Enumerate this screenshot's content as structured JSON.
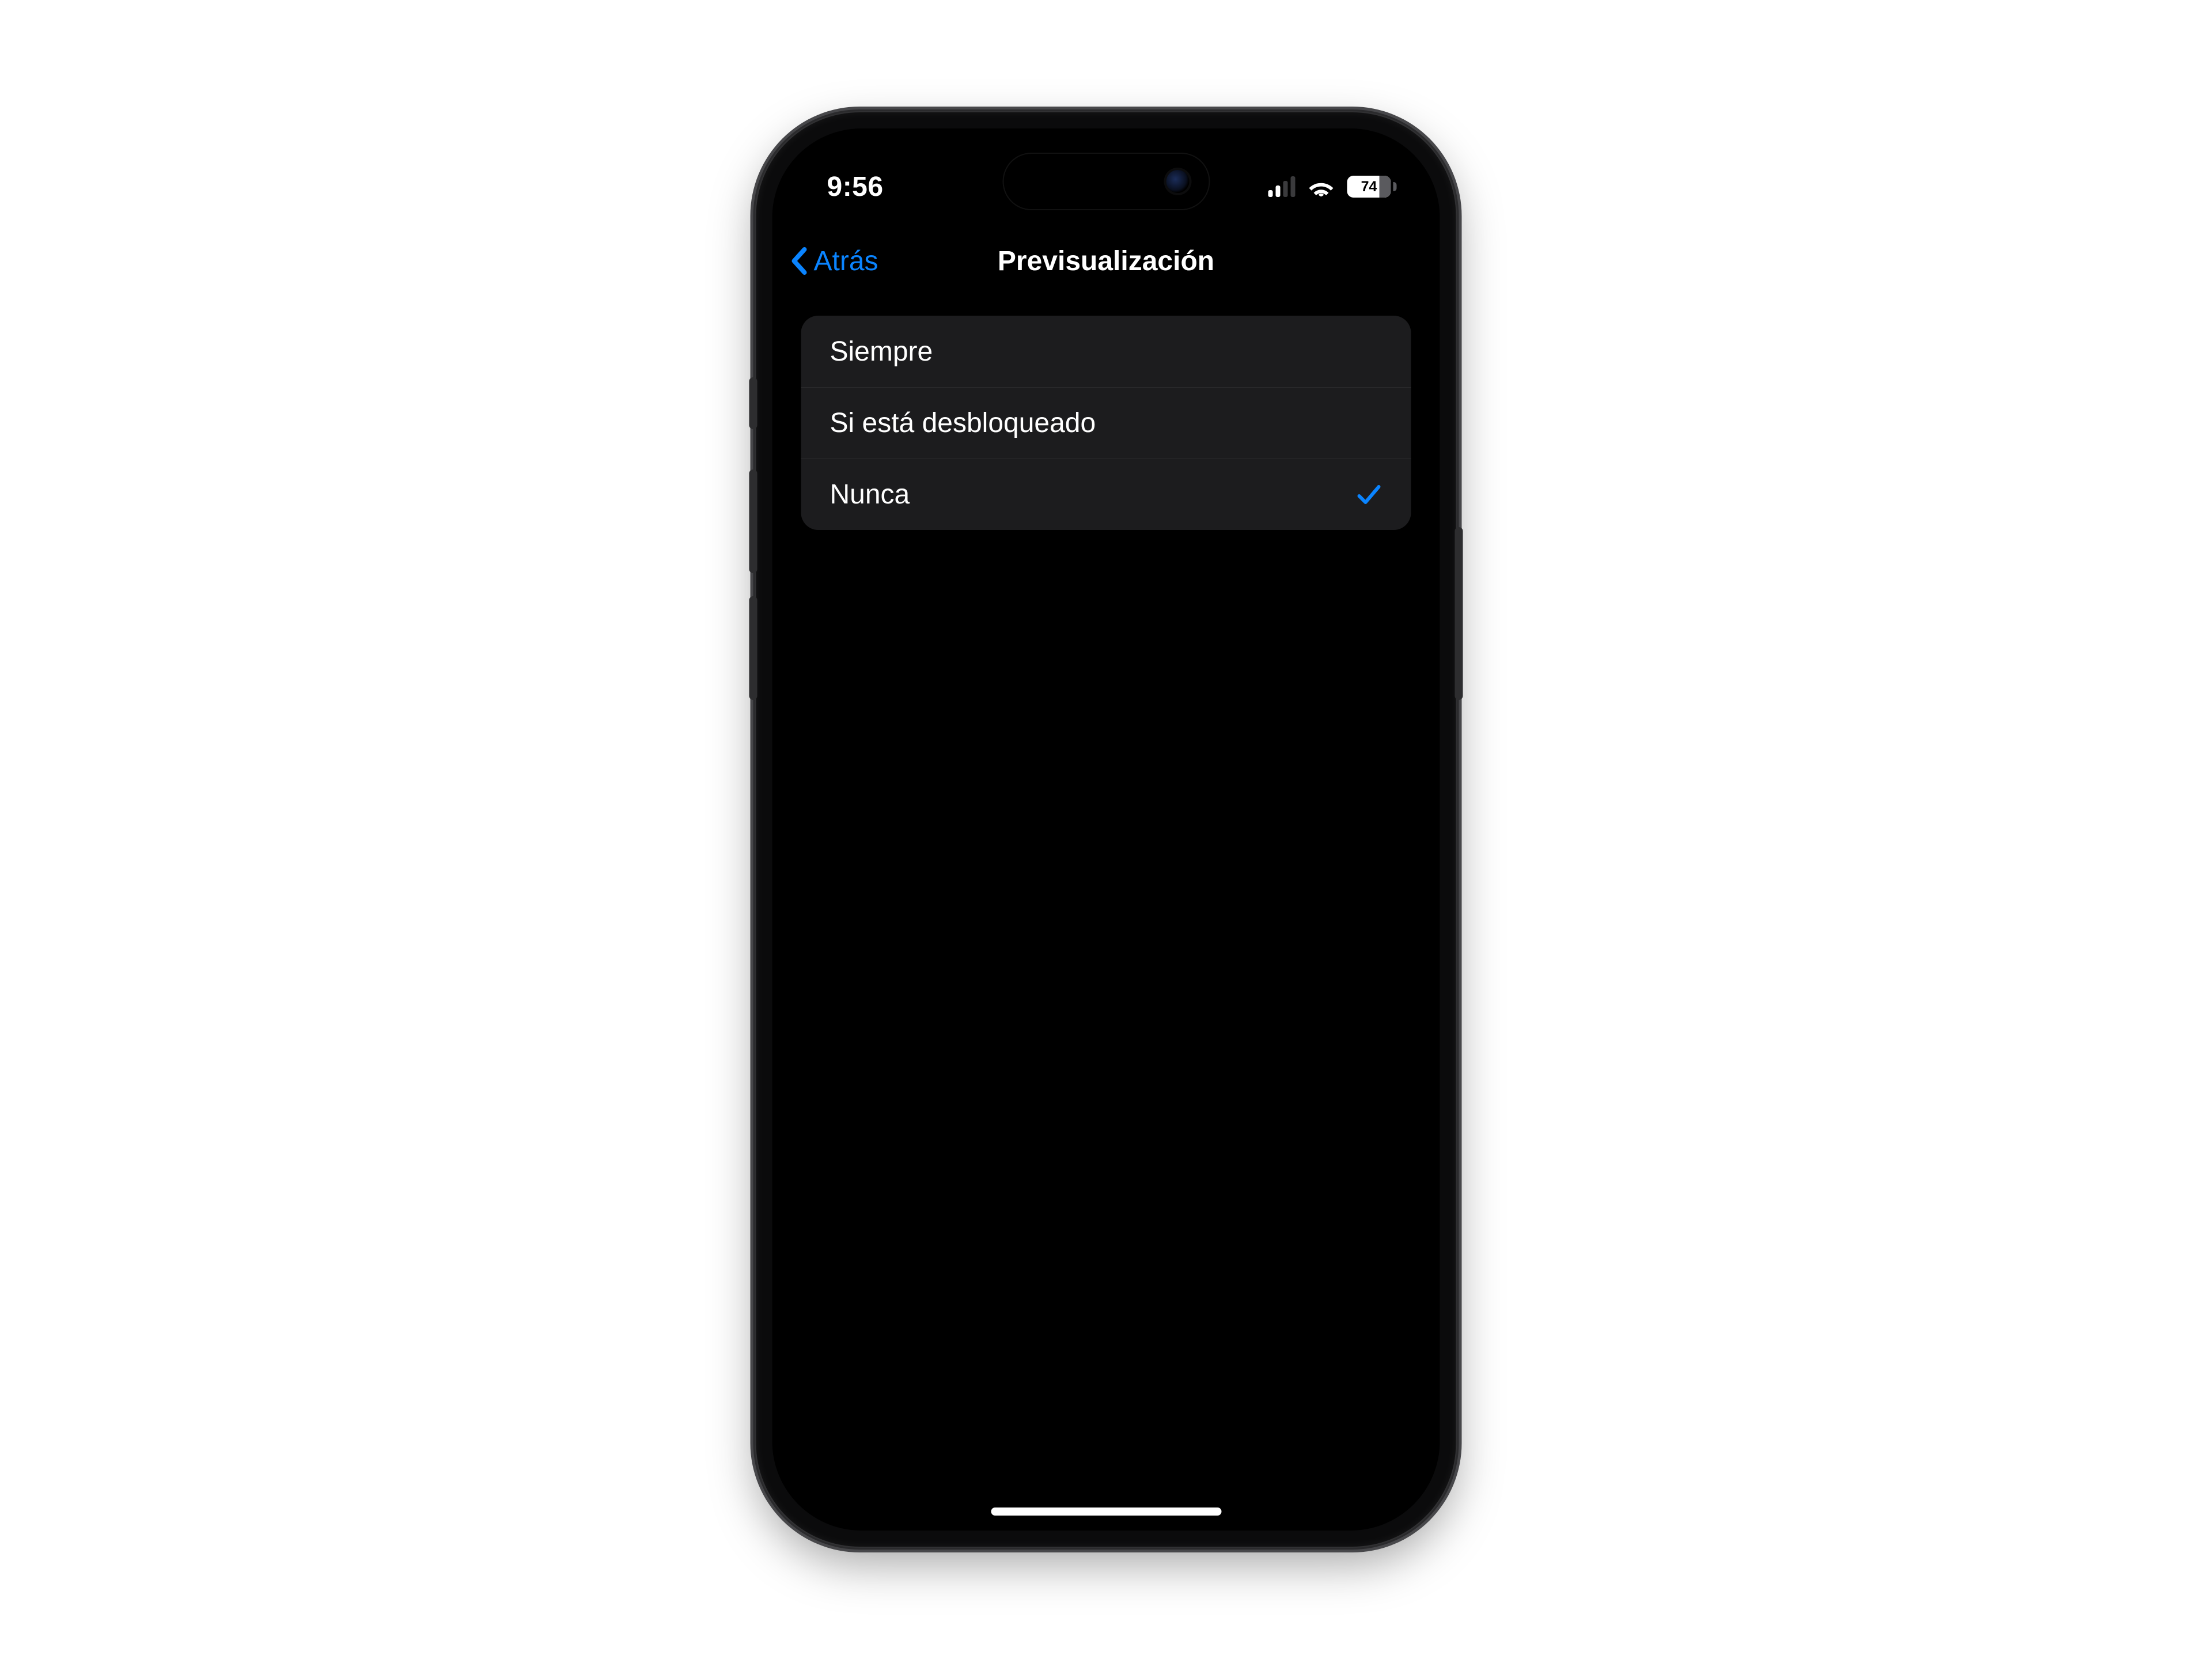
{
  "status": {
    "time": "9:56",
    "signal_bars_active": 2,
    "signal_bars_total": 4,
    "battery_percent": 74
  },
  "nav": {
    "back_label": "Atrás",
    "title": "Previsualización"
  },
  "options": [
    {
      "label": "Siempre",
      "selected": false
    },
    {
      "label": "Si está desbloqueado",
      "selected": false
    },
    {
      "label": "Nunca",
      "selected": true
    }
  ],
  "colors": {
    "accent": "#0a84ff",
    "list_bg": "#1c1c1e"
  }
}
